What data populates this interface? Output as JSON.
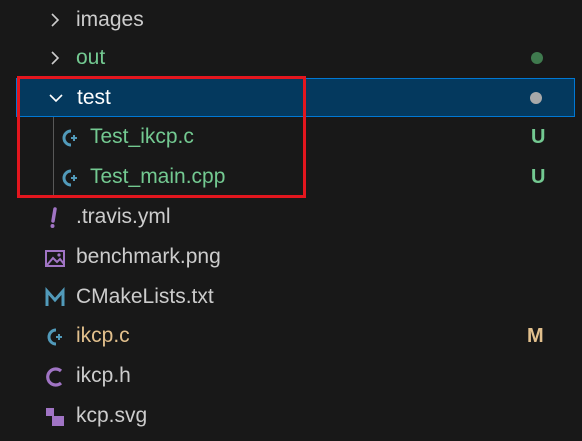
{
  "colors": {
    "background": "#181818",
    "selected_bg": "#04395e",
    "selected_border": "#0078d4",
    "text_default": "#cccccc",
    "text_untracked": "#73c991",
    "text_modified": "#e2c08d",
    "status_untracked": "#73c991",
    "status_modified": "#e2c08d",
    "dot_green": "#3f7a4e",
    "dot_gray": "#a9a9a9",
    "highlight": "#e3161e",
    "icon_cpp": "#519aba",
    "icon_c": "#a074c4",
    "icon_yml": "#a074c4",
    "icon_image": "#a074c4",
    "icon_cmake": "#519aba",
    "icon_svg": "#a074c4"
  },
  "tree": {
    "images": {
      "label": "images",
      "expanded": false
    },
    "out": {
      "label": "out",
      "expanded": false,
      "decoration": "dot"
    },
    "test": {
      "label": "test",
      "expanded": true,
      "decoration": "dot"
    },
    "test_ikcp_c": {
      "label": "Test_ikcp.c",
      "icon": "cpp-icon",
      "status": "U"
    },
    "test_main_cpp": {
      "label": "Test_main.cpp",
      "icon": "cpp-icon",
      "status": "U"
    },
    "travis": {
      "label": ".travis.yml",
      "icon": "yaml-icon"
    },
    "benchmark": {
      "label": "benchmark.png",
      "icon": "image-icon"
    },
    "cmakelists": {
      "label": "CMakeLists.txt",
      "icon": "cmake-icon"
    },
    "ikcp_c": {
      "label": "ikcp.c",
      "icon": "cpp-icon",
      "status": "M"
    },
    "ikcp_h": {
      "label": "ikcp.h",
      "icon": "c-header-icon"
    },
    "kcp_svg": {
      "label": "kcp.svg",
      "icon": "svg-icon"
    }
  }
}
